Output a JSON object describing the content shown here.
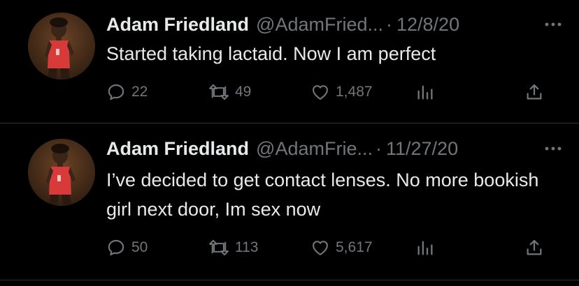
{
  "colors": {
    "background": "#000000",
    "text_primary": "#e7e9ea",
    "text_secondary": "#71767b",
    "divider": "#2f3336"
  },
  "tweets": [
    {
      "display_name": "Adam Friedland",
      "handle": "@AdamFried...",
      "separator": "·",
      "date": "12/8/20",
      "text": "Started taking lactaid. Now I am perfect",
      "replies": "22",
      "retweets": "49",
      "likes": "1,487",
      "icons": [
        "reply-icon",
        "retweet-icon",
        "like-icon",
        "views-icon",
        "share-icon",
        "more-icon"
      ]
    },
    {
      "display_name": "Adam Friedland",
      "handle": "@AdamFrie...",
      "separator": "·",
      "date": "11/27/20",
      "text": "I’ve decided to get contact lenses. No more bookish girl next door, Im sex now",
      "replies": "50",
      "retweets": "113",
      "likes": "5,617",
      "icons": [
        "reply-icon",
        "retweet-icon",
        "like-icon",
        "views-icon",
        "share-icon",
        "more-icon"
      ]
    }
  ]
}
